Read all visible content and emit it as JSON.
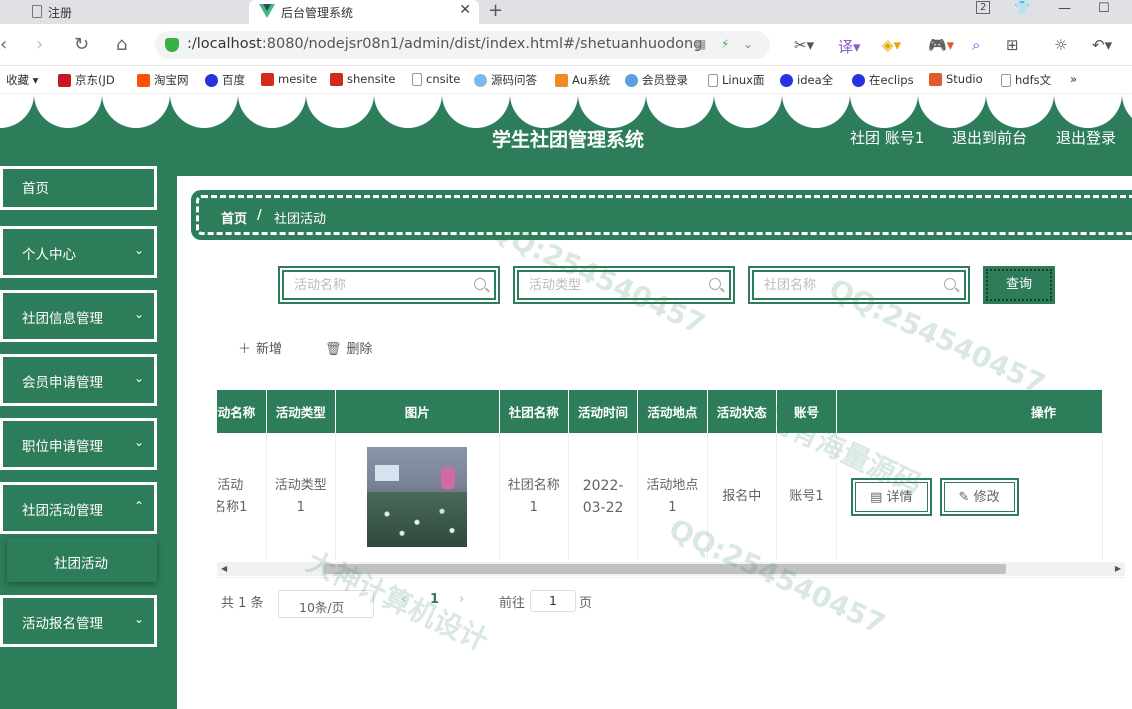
{
  "browser": {
    "tabs": [
      {
        "label": "注册"
      },
      {
        "label": "后台管理系统"
      }
    ],
    "tab_count_badge": "2",
    "url_host": ":/localhost",
    "url_rest": ":8080/nodejsr08n1/admin/dist/index.html#/shetuanhuodong",
    "bookmarks": [
      "收藏",
      "京东(JD",
      "淘宝网",
      "百度",
      "mesite",
      "shensite",
      "cnsite",
      "源码问答",
      "Au系统",
      "会员登录",
      "Linux面",
      "idea全",
      "在eclips",
      "Studio",
      "hdfs文"
    ],
    "bookmark_more": "»"
  },
  "header": {
    "title": "学生社团管理系统",
    "user": "社团 账号1",
    "exit_front": "退出到前台",
    "logout": "退出登录"
  },
  "sidebar": {
    "items": [
      {
        "label": "首页",
        "has_chevron": false
      },
      {
        "label": "个人中心",
        "has_chevron": true
      },
      {
        "label": "社团信息管理",
        "has_chevron": true
      },
      {
        "label": "会员申请管理",
        "has_chevron": true
      },
      {
        "label": "职位申请管理",
        "has_chevron": true
      },
      {
        "label": "社团活动管理",
        "has_chevron": true,
        "expanded": true
      },
      {
        "label": "活动报名管理",
        "has_chevron": true
      }
    ],
    "subitem": "社团活动"
  },
  "breadcrumb": {
    "home": "首页",
    "separator": "/",
    "current": "社团活动"
  },
  "search": {
    "activity_name_placeholder": "活动名称",
    "activity_type_placeholder": "活动类型",
    "club_name_placeholder": "社团名称",
    "query_label": "查询"
  },
  "actions": {
    "add": "新增",
    "delete": "删除"
  },
  "table": {
    "columns": [
      "活动名称",
      "活动类型",
      "图片",
      "社团名称",
      "活动时间",
      "活动地点",
      "活动状态",
      "账号",
      "操作"
    ],
    "rows": [
      {
        "activity_name": "活动名称1",
        "activity_type": "活动类型1",
        "club_name": "社团名称1",
        "time": "2022-03-22",
        "place": "活动地点1",
        "status": "报名中",
        "account": "账号1",
        "ops": [
          "详情",
          "修改"
        ]
      }
    ]
  },
  "pagination": {
    "total": "共 1 条",
    "page_size": "10条/页",
    "current_page": "1",
    "goto_prefix": "前往",
    "goto_value": "1",
    "goto_suffix": "页"
  },
  "colors": {
    "primary": "#2e7d5a",
    "white": "#ffffff",
    "table_text": "#606266"
  },
  "watermark_text": [
    "QQ:254540457",
    "拥有海量源码",
    "大神计算机设计"
  ]
}
